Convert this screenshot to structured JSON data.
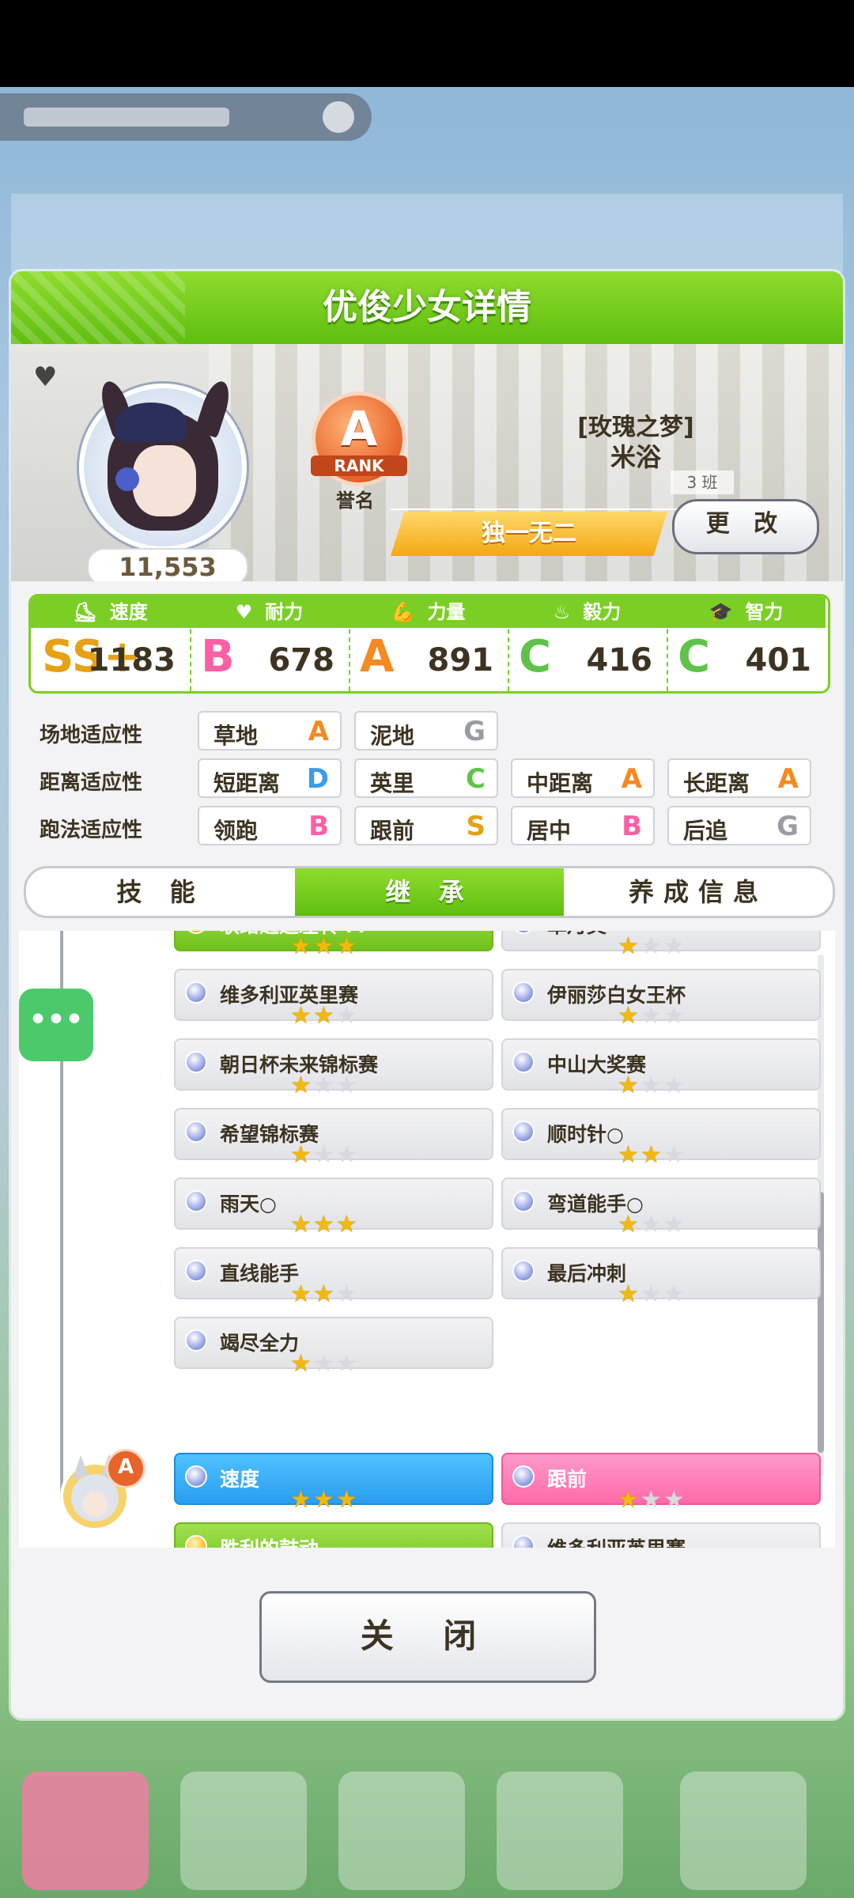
{
  "header": {
    "title": "优俊少女详情"
  },
  "profile": {
    "fans": "11,553",
    "rank_letter": "A",
    "rank_word": "RANK",
    "rank_caption": "誉名",
    "epithet_top": "[玫瑰之梦]",
    "epithet_name": "米浴",
    "class_tag": "3 班",
    "title": "独一无二",
    "change_label": "更 改"
  },
  "stats": [
    {
      "label": "速度",
      "icon": "shoe-icon",
      "grade": "SS+",
      "value": "1183",
      "color": "#e6a115"
    },
    {
      "label": "耐力",
      "icon": "heart-icon",
      "grade": "B",
      "value": "678",
      "color": "#ff5fa4"
    },
    {
      "label": "力量",
      "icon": "muscle-icon",
      "grade": "A",
      "value": "891",
      "color": "#f38a22"
    },
    {
      "label": "毅力",
      "icon": "flame-icon",
      "grade": "C",
      "value": "416",
      "color": "#5fc34a"
    },
    {
      "label": "智力",
      "icon": "grad-cap-icon",
      "grade": "C",
      "value": "401",
      "color": "#5fc34a"
    }
  ],
  "aptitude": {
    "track": {
      "label": "场地适应性",
      "items": [
        {
          "name": "草地",
          "grade": "A"
        },
        {
          "name": "泥地",
          "grade": "G"
        }
      ]
    },
    "distance": {
      "label": "距离适应性",
      "items": [
        {
          "name": "短距离",
          "grade": "D"
        },
        {
          "name": "英里",
          "grade": "C"
        },
        {
          "name": "中距离",
          "grade": "A"
        },
        {
          "name": "长距离",
          "grade": "A"
        }
      ]
    },
    "style": {
      "label": "跑法适应性",
      "items": [
        {
          "name": "领跑",
          "grade": "B"
        },
        {
          "name": "跟前",
          "grade": "S"
        },
        {
          "name": "居中",
          "grade": "B"
        },
        {
          "name": "后追",
          "grade": "G"
        }
      ]
    }
  },
  "grade_colors": {
    "A": "#f38a22",
    "B": "#ff5fa4",
    "C": "#5fc34a",
    "D": "#3a9ce9",
    "S": "#e6a115",
    "G": "#9a9ca3"
  },
  "tabs": [
    "技 能",
    "继 承",
    "养成信息"
  ],
  "active_tab": 1,
  "skills": [
    {
      "name": "联络通道左转 M",
      "stars": 3,
      "style": "green",
      "dot": "gold"
    },
    {
      "name": "皐月奖",
      "stars": 1
    },
    {
      "name": "维多利亚英里赛",
      "stars": 2
    },
    {
      "name": "伊丽莎白女王杯",
      "stars": 1
    },
    {
      "name": "朝日杯未来锦标赛",
      "stars": 1
    },
    {
      "name": "中山大奖赛",
      "stars": 1
    },
    {
      "name": "希望锦标赛",
      "stars": 1
    },
    {
      "name": "顺时针○",
      "stars": 2
    },
    {
      "name": "雨天○",
      "stars": 3
    },
    {
      "name": "弯道能手○",
      "stars": 1
    },
    {
      "name": "直线能手",
      "stars": 2
    },
    {
      "name": "最后冲刺",
      "stars": 1
    },
    {
      "name": "竭尽全力",
      "stars": 1
    }
  ],
  "parent_skills": [
    {
      "name": "速度",
      "stars": 3,
      "style": "blue"
    },
    {
      "name": "跟前",
      "stars": 1,
      "style": "pink"
    },
    {
      "name": "胜利的鼓动",
      "stars": 0,
      "style": "green",
      "dot": "gold"
    },
    {
      "name": "维多利亚英里赛",
      "stars": 0
    }
  ],
  "parent_rank": "A",
  "side_menu_label": "•••",
  "close_label": "关 闭"
}
